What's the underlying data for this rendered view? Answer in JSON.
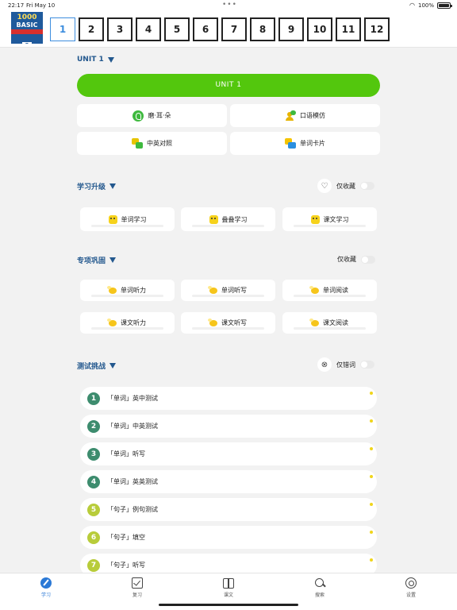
{
  "status_bar": {
    "time": "22:17",
    "date": "Fri May 10",
    "battery": "100%",
    "battery_level": 1.0
  },
  "book_cover": {
    "line1": "1000",
    "line2": "BASIC",
    "volume": "2"
  },
  "unit_tabs": [
    "1",
    "2",
    "3",
    "4",
    "5",
    "6",
    "7",
    "8",
    "9",
    "10",
    "11",
    "12"
  ],
  "active_unit": "1",
  "unit_section": {
    "title": "UNIT 1",
    "main_button": "UNIT 1",
    "items": [
      "磨·耳·朵",
      "口语模仿",
      "中英对照",
      "单词卡片"
    ]
  },
  "upgrade_section": {
    "title": "学习升级",
    "filter_label": "仅收藏",
    "items": [
      "单词学习",
      "叠叠学习",
      "课文学习"
    ]
  },
  "special_section": {
    "title": "专项巩固",
    "filter_label": "仅收藏",
    "items": [
      "单词听力",
      "单词听写",
      "单词阅读",
      "课文听力",
      "课文听写",
      "课文阅读"
    ]
  },
  "test_section": {
    "title": "测试挑战",
    "filter_label": "仅错词",
    "items": [
      {
        "num": "1",
        "label": "「单词」英中测试",
        "color": "#3d8c6e"
      },
      {
        "num": "2",
        "label": "「单词」中英测试",
        "color": "#3d8c6e"
      },
      {
        "num": "3",
        "label": "「单词」听写",
        "color": "#3d8c6e"
      },
      {
        "num": "4",
        "label": "「单词」英英测试",
        "color": "#3d8c6e"
      },
      {
        "num": "5",
        "label": "「句子」例句测试",
        "color": "#b8cc3a"
      },
      {
        "num": "6",
        "label": "「句子」填空",
        "color": "#b8cc3a"
      },
      {
        "num": "7",
        "label": "「句子」听写",
        "color": "#b8cc3a"
      }
    ]
  },
  "tab_bar": [
    "学习",
    "复习",
    "课文",
    "搜索",
    "设置"
  ],
  "colors": {
    "accent_green": "#53c70d",
    "section_title": "#23588e",
    "active_tab": "#2b79d6"
  }
}
